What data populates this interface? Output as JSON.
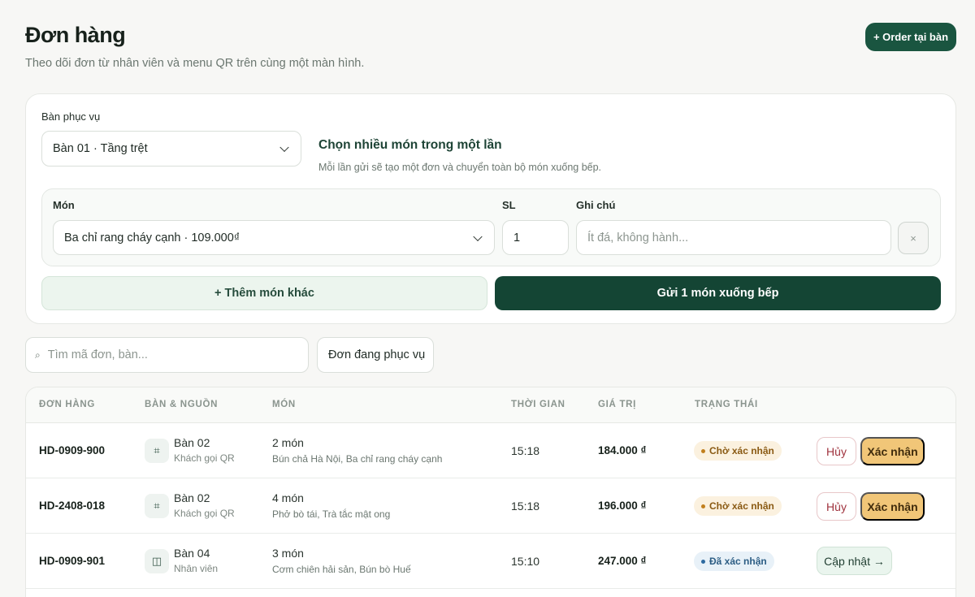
{
  "header": {
    "title": "Đơn hàng",
    "subtitle": "Theo dõi đơn từ nhân viên và menu QR trên cùng một màn hình.",
    "order_button": "+ Order tại bàn"
  },
  "form": {
    "table_label": "Bàn phục vụ",
    "table_value": "Bàn 01 · Tầng trệt",
    "info_title": "Chọn nhiều món trong một lần",
    "info_desc": "Mỗi lần gửi sẽ tạo một đơn và chuyển toàn bộ món xuống bếp.",
    "dish_label": "Món",
    "dish_value": "Ba chỉ rang cháy cạnh · 109.000₫",
    "qty_label": "SL",
    "qty_value": "1",
    "note_label": "Ghi chú",
    "note_placeholder": "Ít đá, không hành...",
    "remove_icon": "×",
    "add_button": "+ Thêm món khác",
    "send_button": "Gửi 1 món xuống bếp"
  },
  "toolbar": {
    "search_icon": "⌕",
    "search_placeholder": "Tìm mã đơn, bàn...",
    "filter_value": "Đơn đang phục vụ"
  },
  "table": {
    "headers": {
      "order": "ĐƠN HÀNG",
      "table_source": "BÀN & NGUỒN",
      "dishes": "MÓN",
      "time": "THỜI GIAN",
      "value": "GIÁ TRỊ",
      "status": "TRẠNG THÁI"
    },
    "rows": [
      {
        "code": "HD-0909-900",
        "icon": "⌗",
        "table": "Bàn 02",
        "source": "Khách gọi QR",
        "dish_count": "2 món",
        "dish_names": "Bún chả Hà Nội, Ba chỉ rang cháy cạnh",
        "time": "15:18",
        "value": "184.000 ₫",
        "status": "Chờ xác nhận",
        "cancel": "Hủy",
        "confirm": "Xác nhận"
      },
      {
        "code": "HD-2408-018",
        "icon": "⌗",
        "table": "Bàn 02",
        "source": "Khách gọi QR",
        "dish_count": "4 món",
        "dish_names": "Phở bò tái, Trà tắc mật ong",
        "time": "15:18",
        "value": "196.000 ₫",
        "status": "Chờ xác nhận",
        "cancel": "Hủy",
        "confirm": "Xác nhận"
      },
      {
        "code": "HD-0909-901",
        "icon": "◫",
        "table": "Bàn 04",
        "source": "Nhân viên",
        "dish_count": "3 món",
        "dish_names": "Cơm chiên hải sản, Bún bò Huế",
        "time": "15:10",
        "value": "247.000 ₫",
        "status": "Đã xác nhận",
        "update": "Cập nhật →"
      }
    ]
  }
}
